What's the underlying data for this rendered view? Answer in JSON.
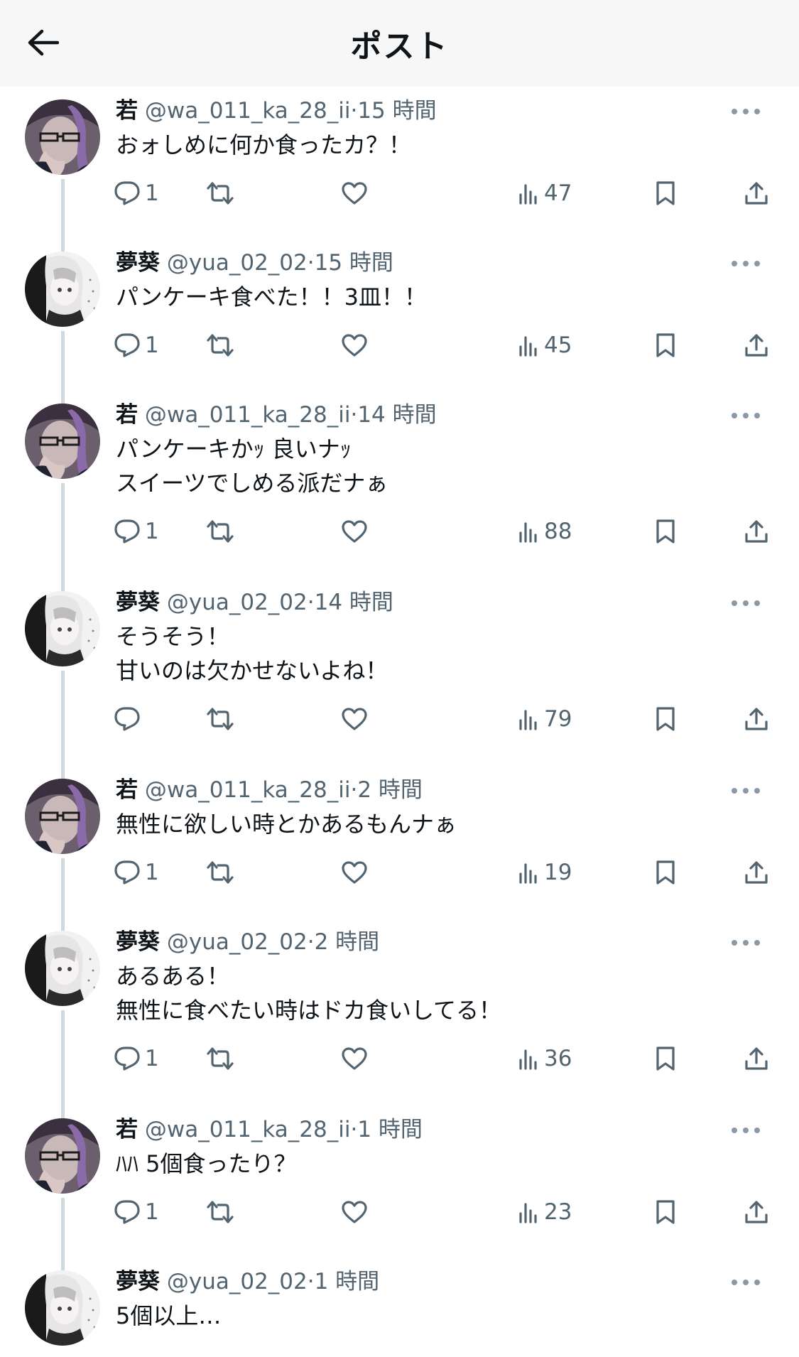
{
  "header": {
    "title": "ポスト",
    "back_icon": "arrow-left-icon"
  },
  "users": {
    "waka": {
      "name": "若",
      "handle": "@wa_011_ka_28_ii"
    },
    "yua": {
      "name": "夢葵",
      "handle": "@yua_02_02"
    }
  },
  "posts": [
    {
      "name": "若",
      "handle": "@wa_011_ka_28_ii",
      "dot": "·",
      "time": "15 時間",
      "lines": [
        "おォしめに何か食ったカ？！"
      ],
      "replies": "1",
      "views": "47"
    },
    {
      "name": "夢葵",
      "handle": "@yua_02_02",
      "dot": "·",
      "time": "15 時間",
      "lines": [
        "パンケーキ食べた！！3皿！！"
      ],
      "replies": "1",
      "views": "45"
    },
    {
      "name": "若",
      "handle": "@wa_011_ka_28_ii",
      "dot": "·",
      "time": "14 時間",
      "lines": [
        "パンケーキかｯ 良いナｯ",
        "スイーツでしめる派だナぁ"
      ],
      "replies": "1",
      "views": "88"
    },
    {
      "name": "夢葵",
      "handle": "@yua_02_02",
      "dot": "·",
      "time": "14 時間",
      "lines": [
        "そうそう！",
        "甘いのは欠かせないよね！"
      ],
      "replies": "",
      "views": "79"
    },
    {
      "name": "若",
      "handle": "@wa_011_ka_28_ii",
      "dot": "·",
      "time": "2 時間",
      "lines": [
        "無性に欲しい時とかあるもんナぁ"
      ],
      "replies": "1",
      "views": "19"
    },
    {
      "name": "夢葵",
      "handle": "@yua_02_02",
      "dot": "·",
      "time": "2 時間",
      "lines": [
        "あるある！",
        "無性に食べたい時はドカ食いしてる！"
      ],
      "replies": "1",
      "views": "36"
    },
    {
      "name": "若",
      "handle": "@wa_011_ka_28_ii",
      "dot": "·",
      "time": "1 時間",
      "lines": [
        "ﾊﾊ 5個食ったり？"
      ],
      "replies": "1",
      "views": "23"
    },
    {
      "name": "夢葵",
      "handle": "@yua_02_02",
      "dot": "·",
      "time": "1 時間",
      "lines": [
        "5個以上…"
      ]
    }
  ],
  "icons": {
    "reply": "reply-icon",
    "repost": "repost-icon",
    "like": "heart-icon",
    "views": "views-icon",
    "bookmark": "bookmark-icon",
    "share": "share-icon",
    "more": "more-icon"
  },
  "colors": {
    "text": "#0f1419",
    "secondary": "#536471",
    "thread_line": "#cfd9de",
    "header_bg": "#f7f7f7"
  }
}
